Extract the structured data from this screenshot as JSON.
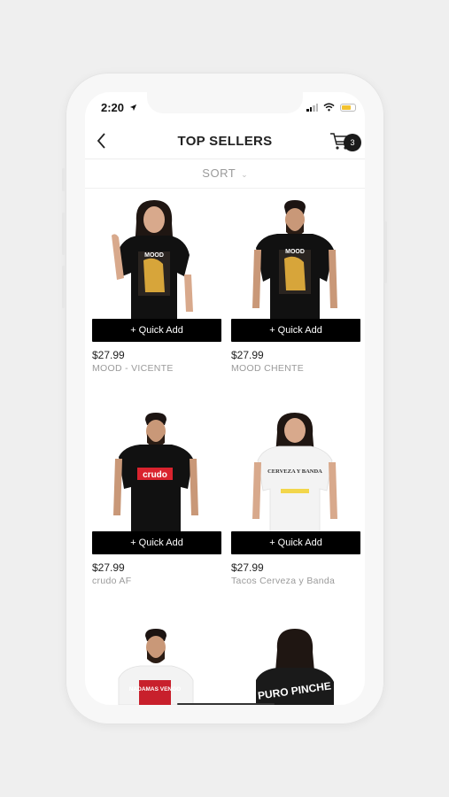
{
  "status_bar": {
    "time": "2:20",
    "location_icon": "location-arrow-icon"
  },
  "header": {
    "title": "TOP SELLERS",
    "back_icon": "chevron-left-icon",
    "cart_icon": "shopping-cart-icon",
    "cart_count": "3"
  },
  "sort": {
    "label": "SORT",
    "chevron_icon": "chevron-down-icon"
  },
  "products": [
    {
      "quick_add": "+ Quick Add",
      "price": "$27.99",
      "name": "MOOD - VICENTE",
      "shirt_color": "#111111",
      "print": "MOOD"
    },
    {
      "quick_add": "+ Quick Add",
      "price": "$27.99",
      "name": "MOOD  CHENTE",
      "shirt_color": "#111111",
      "print": "MOOD"
    },
    {
      "quick_add": "+ Quick Add",
      "price": "$27.99",
      "name": "crudo AF",
      "shirt_color": "#111111",
      "print": "crudo"
    },
    {
      "quick_add": "+ Quick Add",
      "price": "$27.99",
      "name": "Tacos Cerveza y Banda",
      "shirt_color": "#f3f3f3",
      "print": "CERVEZA Y BANDA"
    },
    {
      "print": "NADAMAS VENGO",
      "shirt_color": "#f3f3f3"
    },
    {
      "print": "PURO PINCHE",
      "shirt_color": "#111111"
    }
  ],
  "colors": {
    "accent_black": "#000000",
    "muted_text": "#9a9a9a",
    "battery": "#f2c230"
  }
}
